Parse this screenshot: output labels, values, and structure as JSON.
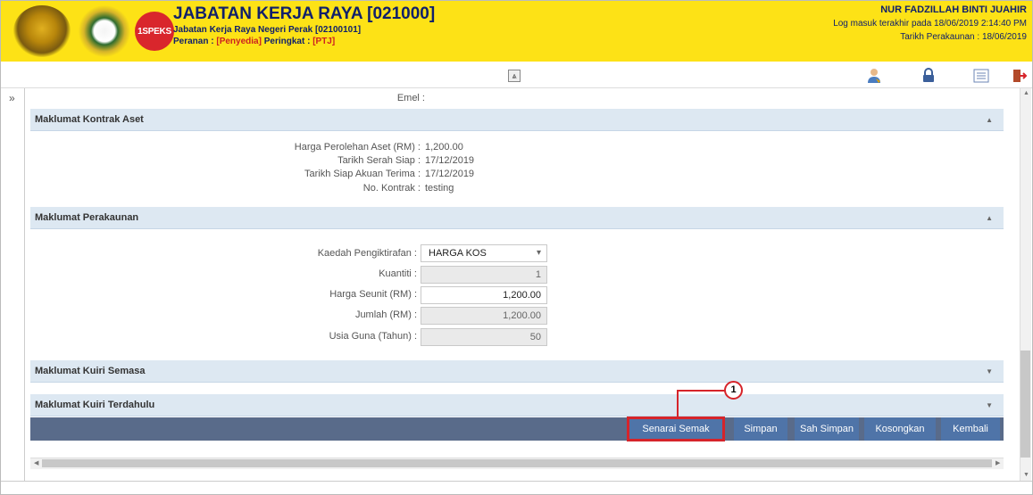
{
  "header": {
    "title": "JABATAN KERJA RAYA [021000]",
    "subtitle": "Jabatan Kerja Raya Negeri Perak [02100101]",
    "role_label": "Peranan :",
    "role_value": "[Penyedia]",
    "level_label": "Peringkat :",
    "level_value": "[PTJ]",
    "logo_text": "1SPEKS",
    "user_name": "NUR FADZILLAH BINTI JUAHIR",
    "last_login": "Log masuk terakhir pada 18/06/2019 2:14:40 PM",
    "accounting_date": "Tarikh Perakaunan : 18/06/2019"
  },
  "toolbar": {
    "collapse_glyph": "⩓",
    "expand_glyph": "»"
  },
  "email": {
    "label": "Emel :"
  },
  "kontrak": {
    "title": "Maklumat Kontrak Aset",
    "rows": [
      {
        "label": "Harga Perolehan Aset (RM) :",
        "value": "1,200.00"
      },
      {
        "label": "Tarikh Serah Siap :",
        "value": "17/12/2019"
      },
      {
        "label": "Tarikh Siap Akuan Terima :",
        "value": "17/12/2019"
      },
      {
        "label": "No. Kontrak :",
        "value": "testing"
      }
    ]
  },
  "perakaunan": {
    "title": "Maklumat Perakaunan",
    "kaedah_label": "Kaedah Pengiktirafan :",
    "kaedah_value": "HARGA KOS",
    "kuantiti_label": "Kuantiti :",
    "kuantiti_value": "1",
    "harga_label": "Harga Seunit (RM) :",
    "harga_value": "1,200.00",
    "jumlah_label": "Jumlah (RM) :",
    "jumlah_value": "1,200.00",
    "usia_label": "Usia Guna (Tahun) :",
    "usia_value": "50"
  },
  "kuiri_semasa": {
    "title": "Maklumat Kuiri Semasa"
  },
  "kuiri_terdahulu": {
    "title": "Maklumat Kuiri Terdahulu"
  },
  "buttons": {
    "senarai_semak": "Senarai Semak",
    "simpan": "Simpan",
    "sah_simpan": "Sah Simpan",
    "kosongkan": "Kosongkan",
    "kembali": "Kembali"
  },
  "annotation": {
    "number": "1"
  },
  "colors": {
    "header_bg": "#fde216",
    "section_bg": "#dde8f2",
    "button_bg": "#4f74a8",
    "button_bar": "#596b8a",
    "highlight": "#d6242a"
  }
}
